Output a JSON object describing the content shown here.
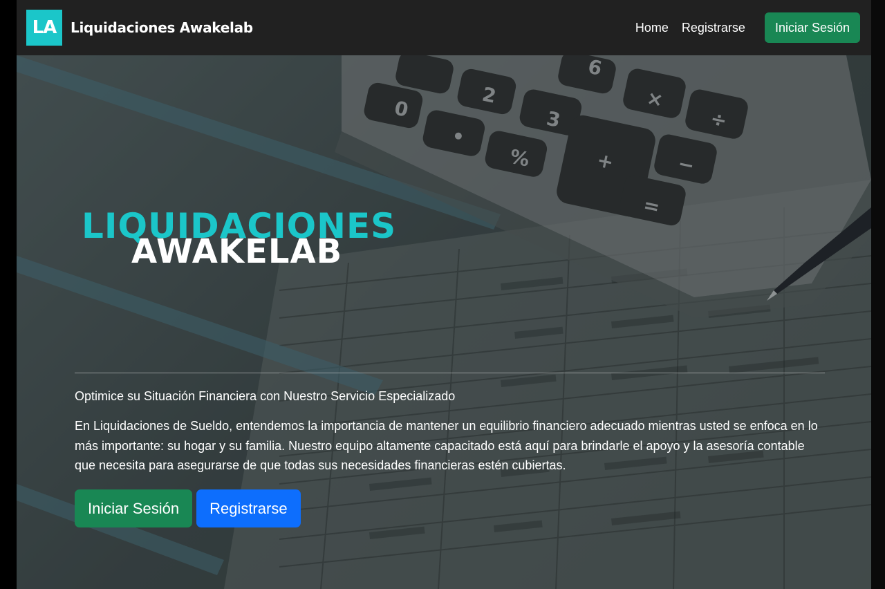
{
  "navbar": {
    "logo_initials": "LA",
    "brand": "Liquidaciones Awakelab",
    "links": [
      "Home",
      "Registrarse"
    ],
    "login_button": "Iniciar Sesión"
  },
  "hero": {
    "logo_line1": "LIQUIDACIONES",
    "logo_line2": "AWAKELAB",
    "subtitle": "Optimice su Situación Financiera con Nuestro Servicio Especializado",
    "description": "En Liquidaciones de Sueldo, entendemos la importancia de mantener un equilibrio financiero adecuado mientras usted se enfoca en lo más importante: su hogar y su familia. Nuestro equipo altamente capacitado está aquí para brindarle el apoyo y la asesoría contable que necesita para asegurarse de que todas sus necesidades financieras estén cubiertas.",
    "primary_button": "Iniciar Sesión",
    "secondary_button": "Registrarse"
  },
  "colors": {
    "accent": "#1bc6c9",
    "success": "#198754",
    "primary": "#0d6efd",
    "navbar_bg": "#212121"
  }
}
